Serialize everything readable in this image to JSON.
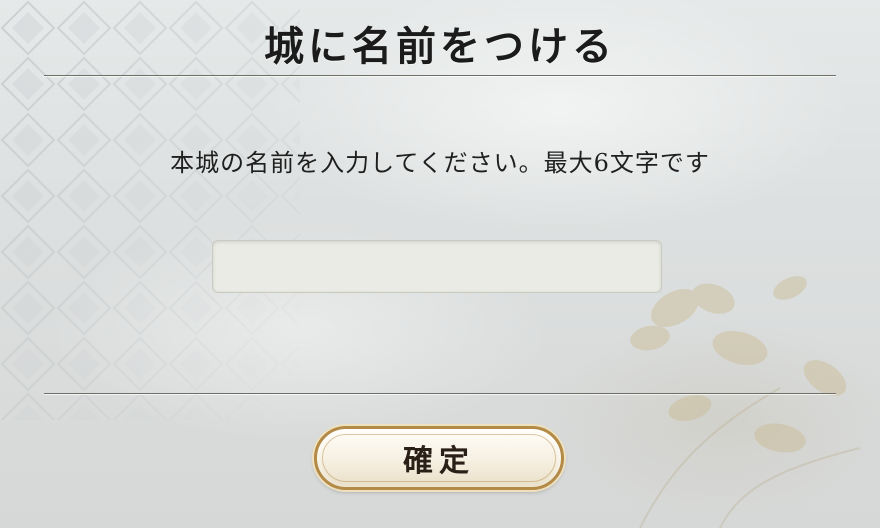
{
  "dialog": {
    "title": "城に名前をつける",
    "message": "本城の名前を入力してください。最大6文字です",
    "name_input": {
      "value": "",
      "placeholder": ""
    },
    "confirm_label": "確定"
  },
  "colors": {
    "background": "#dde0e0",
    "divider": "#6e6e68",
    "button_border": "#b38a46",
    "input_background": "#e9ebe4"
  },
  "icons": {
    "background_pattern": "diamond-pattern-icon",
    "decoration": "flower-decoration-icon"
  }
}
